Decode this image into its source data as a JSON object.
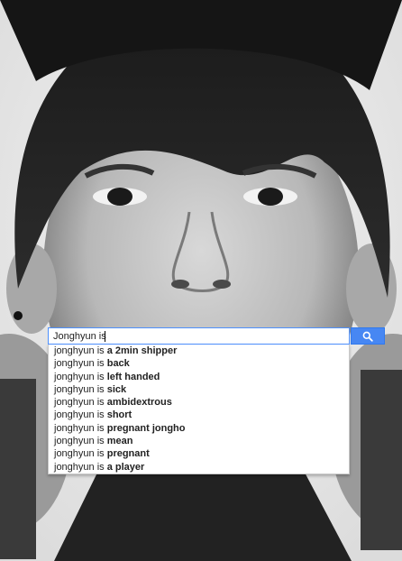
{
  "search": {
    "query": "Jonghyun is",
    "button_icon": "search-icon"
  },
  "suggestions": [
    {
      "prefix": "jonghyun is ",
      "completion": "a 2min shipper"
    },
    {
      "prefix": "jonghyun is ",
      "completion": "back"
    },
    {
      "prefix": "jonghyun is ",
      "completion": "left handed"
    },
    {
      "prefix": "jonghyun is ",
      "completion": "sick"
    },
    {
      "prefix": "jonghyun is ",
      "completion": "ambidextrous"
    },
    {
      "prefix": "jonghyun is ",
      "completion": "short"
    },
    {
      "prefix": "jonghyun is ",
      "completion": "pregnant jongho"
    },
    {
      "prefix": "jonghyun is ",
      "completion": "mean"
    },
    {
      "prefix": "jonghyun is ",
      "completion": "pregnant"
    },
    {
      "prefix": "jonghyun is ",
      "completion": "a player"
    }
  ],
  "colors": {
    "accent": "#4787f3",
    "input_border": "#4d90fe"
  }
}
